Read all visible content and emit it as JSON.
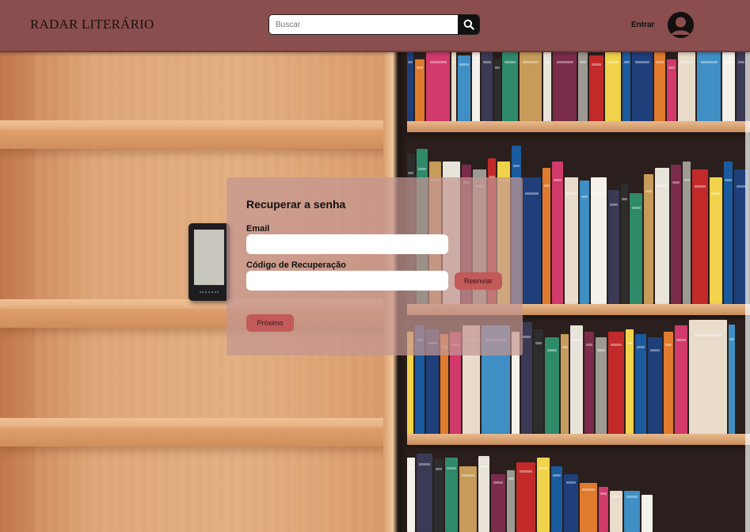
{
  "header": {
    "brand": "RADAR LITERÁRIO",
    "search": {
      "placeholder": "Buscar",
      "value": "",
      "icon": "search-icon"
    },
    "login_label": "Entrar",
    "avatar_icon": "user-avatar-icon"
  },
  "recover_form": {
    "title": "Recuperar a senha",
    "email_label": "Email",
    "email_value": "",
    "code_label": "Código de Recuperação",
    "code_value": "",
    "resend_label": "Reenviar",
    "next_label": "Próximo"
  },
  "colors": {
    "header_bg": "#8a4e4f",
    "card_bg": "#c49692",
    "button_red": "#c25a5a"
  }
}
